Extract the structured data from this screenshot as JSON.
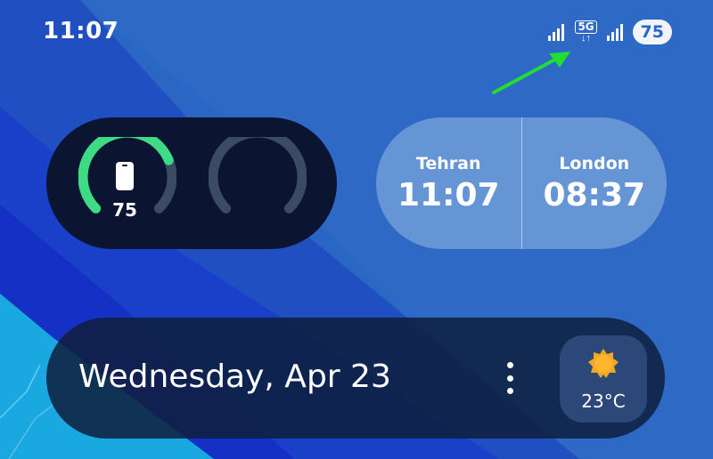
{
  "status_bar": {
    "time": "11:07",
    "network_type": "5G",
    "network_activity": "↓↑",
    "battery_level": "75",
    "signal_icon": "signal-bars-icon"
  },
  "annotation": {
    "arrow_color": "#22dd33"
  },
  "battery_widget": {
    "device_icon": "phone-icon",
    "device_level": "75",
    "device_fraction": 0.75,
    "accent_color": "#3ddc84"
  },
  "world_clock": {
    "cities": [
      {
        "name": "Tehran",
        "time": "11:07"
      },
      {
        "name": "London",
        "time": "08:37"
      }
    ]
  },
  "date_widget": {
    "date": "Wednesday, Apr 23",
    "menu_icon": "more-vertical-icon",
    "weather_icon": "sun-icon",
    "temperature": "23°C"
  }
}
